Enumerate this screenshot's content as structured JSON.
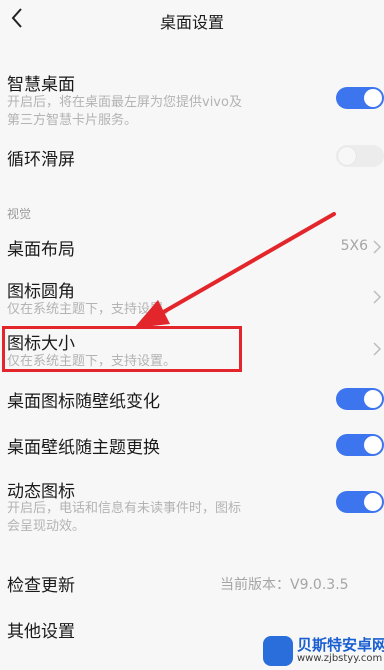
{
  "header": {
    "title": "桌面设置",
    "back_icon": "chevron-left-icon"
  },
  "smart_desktop": {
    "label": "智慧桌面",
    "desc_line1": "开启后，将在桌面最左屏为您提供vivo及",
    "desc_line2": "第三方智慧卡片服务。",
    "enabled": true
  },
  "loop_scroll": {
    "label": "循环滑屏",
    "enabled": false
  },
  "section_visual": "视觉",
  "desktop_layout": {
    "label": "桌面布局",
    "value": "5X6"
  },
  "icon_corner": {
    "label": "图标圆角",
    "desc": "仅在系统主题下，支持设置。"
  },
  "icon_size": {
    "label": "图标大小",
    "desc": "仅在系统主题下，支持设置。"
  },
  "icon_follow_wallpaper": {
    "label": "桌面图标随壁纸变化",
    "enabled": true
  },
  "wallpaper_follow_theme": {
    "label": "桌面壁纸随主题更换",
    "enabled": true
  },
  "dynamic_icon": {
    "label": "动态图标",
    "desc_line1": "开启后，电话和信息有未读事件时，图标",
    "desc_line2": "会呈现动效。",
    "enabled": true
  },
  "check_update": {
    "label": "检查更新",
    "value": "当前版本：V9.0.3.5"
  },
  "other_settings": {
    "label": "其他设置"
  },
  "annotation": {
    "highlight_color": "#e3262b",
    "accent_color": "#3c75ee"
  },
  "watermark": {
    "brand": "贝斯特安卓网",
    "url": "www.zjbstyy.com"
  }
}
